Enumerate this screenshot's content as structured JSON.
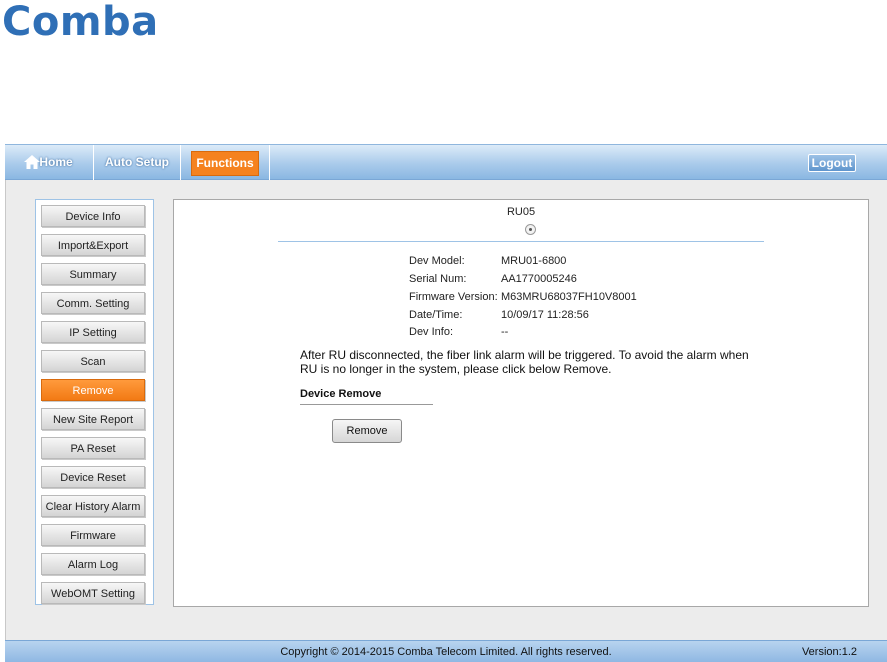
{
  "logo": "Comba",
  "nav": {
    "home": "Home",
    "auto_setup": "Auto Setup",
    "functions": "Functions",
    "logout": "Logout"
  },
  "sidebar": {
    "items": [
      {
        "label": "Device Info"
      },
      {
        "label": "Import&Export"
      },
      {
        "label": "Summary"
      },
      {
        "label": "Comm. Setting"
      },
      {
        "label": "IP Setting"
      },
      {
        "label": "Scan"
      },
      {
        "label": "Remove",
        "active": true
      },
      {
        "label": "New Site Report"
      },
      {
        "label": "PA Reset"
      },
      {
        "label": "Device Reset"
      },
      {
        "label": "Clear History Alarm"
      },
      {
        "label": "Firmware"
      },
      {
        "label": "Alarm Log"
      },
      {
        "label": "WebOMT Setting"
      }
    ]
  },
  "main": {
    "unit_name": "RU05",
    "info": [
      {
        "label": "Dev Model:",
        "value": "MRU01-6800"
      },
      {
        "label": "Serial Num:",
        "value": "AA1770005246"
      },
      {
        "label": "Firmware Version:",
        "value": "M63MRU68037FH10V8001"
      },
      {
        "label": "Date/Time:",
        "value": "10/09/17 11:28:56"
      },
      {
        "label": "Dev Info:",
        "value": "--"
      }
    ],
    "note": "After RU disconnected, the fiber link alarm will be triggered. To avoid the alarm when RU is no longer in the system, please click below Remove.",
    "section_title": "Device Remove",
    "remove_button": "Remove"
  },
  "footer": {
    "copyright": "Copyright © 2014-2015 Comba Telecom Limited. All rights reserved.",
    "version": "Version:1.2"
  },
  "colors": {
    "accent": "#f5821f",
    "nav": "#8ab7e2",
    "logo": "#2f6fb6"
  }
}
